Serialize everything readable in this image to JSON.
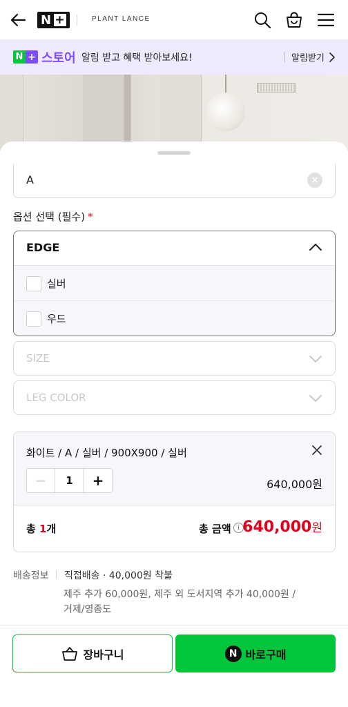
{
  "header": {
    "back_icon": "back-arrow-icon",
    "logo_text": "N",
    "logo_plus": "+",
    "brand": "PLANT LANCE",
    "icons": [
      "search-icon",
      "shopping-bag-icon",
      "menu-icon"
    ]
  },
  "banner": {
    "badge_n": "N",
    "badge_plus": "+",
    "store_label": "스토어",
    "message": "알림 받고 혜택 받아보세요!",
    "alarm_link": "알림받기",
    "accent": "#7d4cff"
  },
  "form": {
    "selected_value_a": "A",
    "option_label": "옵션 선택 (필수)",
    "required_mark": "*",
    "dropdown": {
      "title": "EDGE",
      "options": [
        {
          "label": "실버",
          "checked": false
        },
        {
          "label": "우드",
          "checked": false
        }
      ]
    },
    "size_placeholder": "SIZE",
    "leg_color_placeholder": "LEG COLOR"
  },
  "selection": {
    "name": "화이트 / A / 실버 / 900X900 / 실버",
    "quantity": "1",
    "minus": "−",
    "plus": "+",
    "price": "640,000원",
    "total_count_prefix": "총 ",
    "total_count_num": "1",
    "total_count_suffix": "개",
    "total_label": "총 금액",
    "info_glyph": "i",
    "total_price": "640,000",
    "total_won": "원"
  },
  "shipping": {
    "label": "배송정보",
    "value": "직접배송 · 40,000원 착불",
    "extra": "제주 추가 60,000원, 제주 외 도서지역 추가 40,000원 / 거제/영종도"
  },
  "actions": {
    "cart_label": "장바구니",
    "buy_logo": "N",
    "buy_label": "바로구매",
    "brand_green": "#02c73c",
    "price_red": "#e0001b"
  }
}
